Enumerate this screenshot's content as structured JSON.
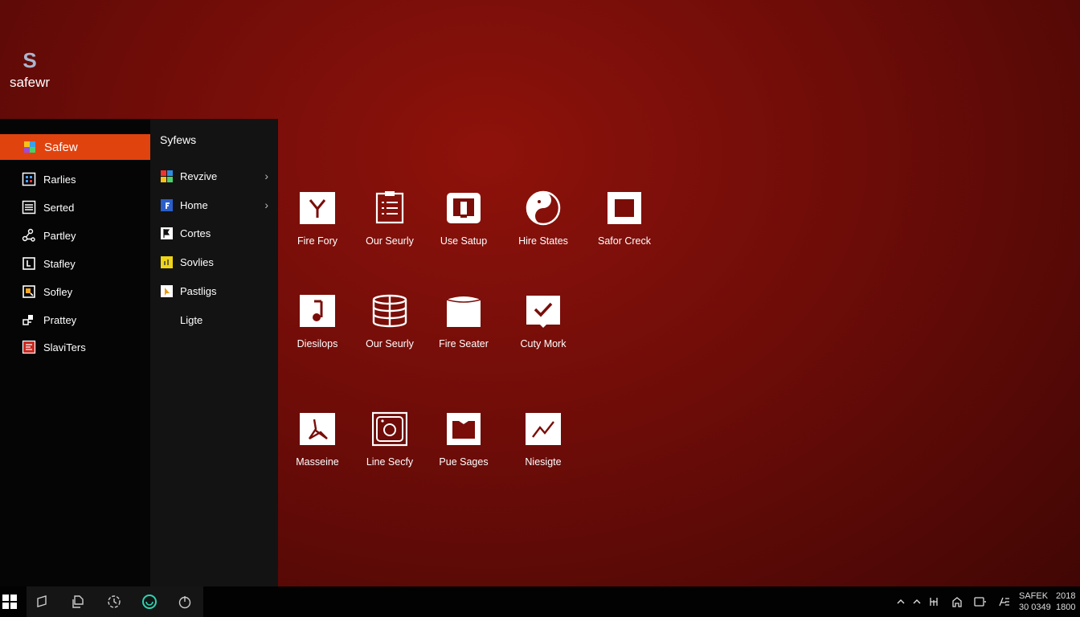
{
  "desktop": {
    "logo_letter": "S",
    "logo_name": "safewr"
  },
  "left_menu": {
    "items": [
      {
        "label": "Safew",
        "icon": "colorful-app-icon"
      },
      {
        "label": "Rarlies",
        "icon": "grid-icon"
      },
      {
        "label": "Serted",
        "icon": "list-icon"
      },
      {
        "label": "Partley",
        "icon": "share-nodes-icon"
      },
      {
        "label": "Stafley",
        "icon": "frame-icon"
      },
      {
        "label": "Sofley",
        "icon": "square-badge-icon"
      },
      {
        "label": "Prattey",
        "icon": "stack-icon"
      },
      {
        "label": "SlaviTers",
        "icon": "red-app-icon"
      }
    ]
  },
  "mid_menu": {
    "title": "Syfews",
    "items": [
      {
        "label": "Revzive",
        "icon": "tiles-icon",
        "has_submenu": true
      },
      {
        "label": "Home",
        "icon": "home-app-icon",
        "has_submenu": true
      },
      {
        "label": "Cortes",
        "icon": "flag-icon",
        "has_submenu": false
      },
      {
        "label": "Sovlies",
        "icon": "yellow-app-icon",
        "has_submenu": false
      },
      {
        "label": "Pastligs",
        "icon": "pointer-icon",
        "has_submenu": false
      },
      {
        "label": "Ligte",
        "icon": "",
        "has_submenu": false
      }
    ]
  },
  "tiles": {
    "row1": [
      {
        "label": "Fire Fory",
        "icon": "y-letter-icon"
      },
      {
        "label": "Our Seurly",
        "icon": "document-list-icon"
      },
      {
        "label": "Use Satup",
        "icon": "monitor-icon"
      },
      {
        "label": "Hire States",
        "icon": "yin-yang-icon"
      },
      {
        "label": "Safor Creck",
        "icon": "square-frame-icon"
      }
    ],
    "row2": [
      {
        "label": "Diesilops",
        "icon": "music-note-icon"
      },
      {
        "label": "Our Seurly",
        "icon": "database-icon"
      },
      {
        "label": "Fire Seater",
        "icon": "box-icon"
      },
      {
        "label": "Cuty Mork",
        "icon": "checkmark-icon"
      }
    ],
    "row3": [
      {
        "label": "Masseine",
        "icon": "pdf-icon"
      },
      {
        "label": "Line Secfy",
        "icon": "camera-icon"
      },
      {
        "label": "Pue Sages",
        "icon": "book-icon"
      },
      {
        "label": "Niesigte",
        "icon": "trend-line-icon"
      }
    ]
  },
  "taskbar": {
    "apps": [
      "start-icon",
      "pen-icon",
      "copy-icon",
      "clock-refresh-icon",
      "chat-icon",
      "power-clock-icon"
    ],
    "tray": [
      "chevron-up-icon",
      "chevron-up-icon",
      "network-icon",
      "home-icon",
      "display-icon",
      "language-icon"
    ],
    "clock_line1": "SAFEK",
    "clock_line2": "30 0349",
    "date_line1": "2018",
    "date_line2": "1800"
  },
  "colors": {
    "accent": "#e1430f",
    "background": "#7a0d08",
    "panel_dark": "#050505",
    "panel_mid": "#131313"
  }
}
